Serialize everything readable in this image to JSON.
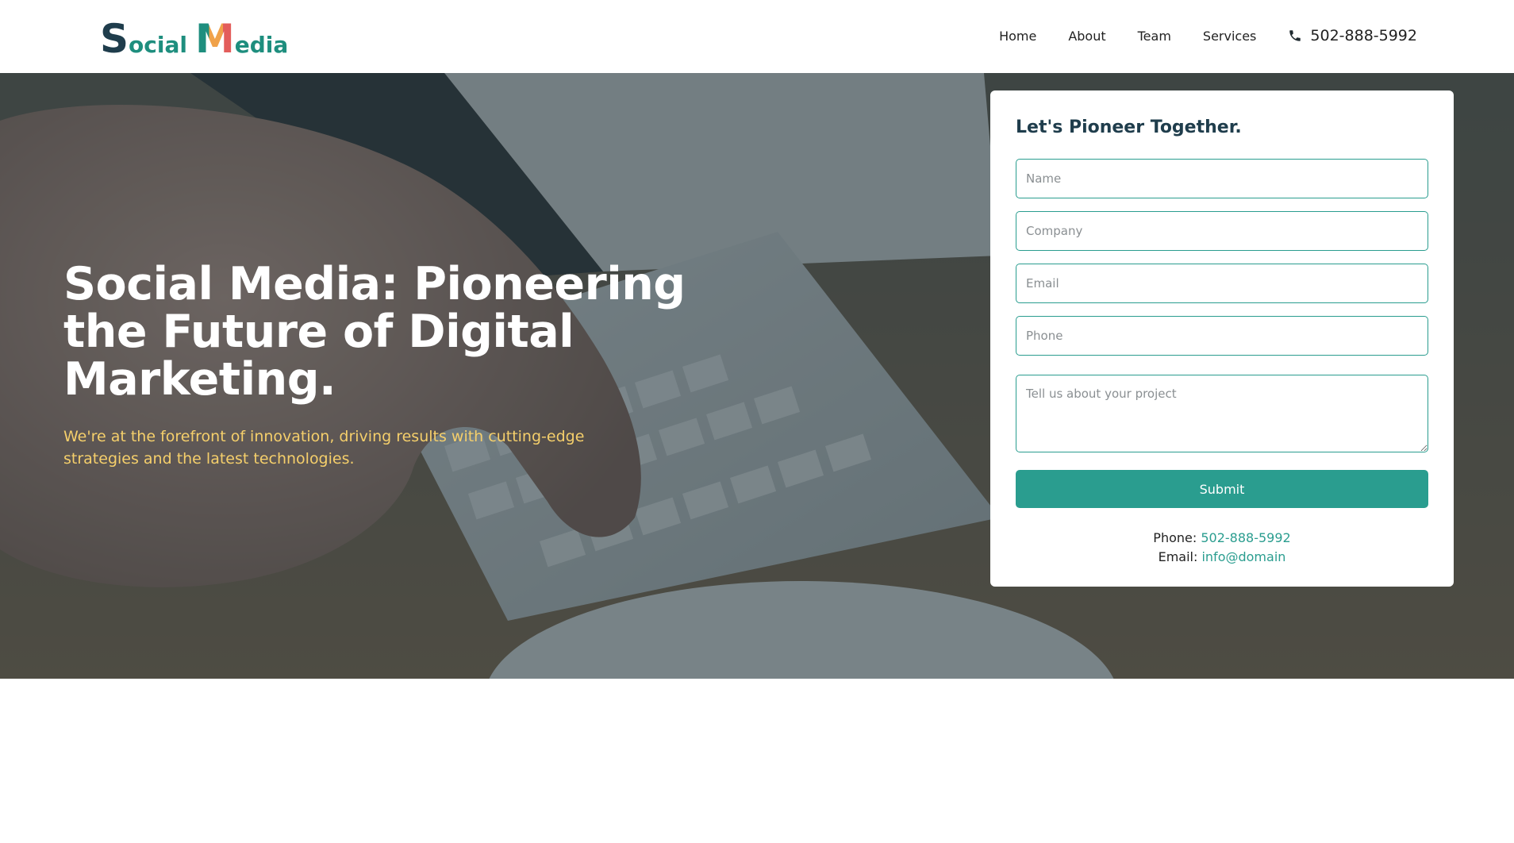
{
  "brand": {
    "logo_first_cap": "S",
    "logo_first_rest": "ocial",
    "logo_second_cap": "M",
    "logo_second_rest": "edia"
  },
  "nav": {
    "items": [
      "Home",
      "About",
      "Team",
      "Services"
    ],
    "phone": "502-888-5992",
    "phone_icon": "phone-icon"
  },
  "hero": {
    "title": "Social Media: Pioneering the Future of Digital Marketing.",
    "subtitle": "We're at the forefront of innovation, driving results with cutting-edge strategies and the latest technologies."
  },
  "form": {
    "title": "Let's Pioneer Together.",
    "name_placeholder": "Name",
    "company_placeholder": "Company",
    "email_placeholder": "Email",
    "phone_placeholder": "Phone",
    "project_placeholder": "Tell us about your project",
    "submit_label": "Submit",
    "phone_label": "Phone:",
    "phone_value": "502-888-5992",
    "email_label": "Email:",
    "email_value": "info@domain"
  },
  "colors": {
    "accent": "#2a9d8f",
    "heading": "#1f3d4c",
    "subtitle": "#f5cf6b"
  }
}
